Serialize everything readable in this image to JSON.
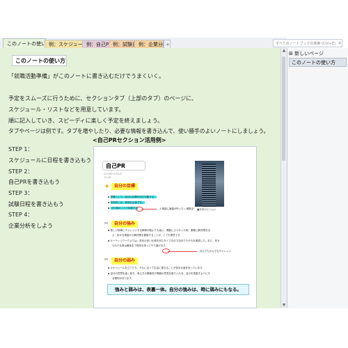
{
  "tabs": [
    {
      "label": "このノートの使い方"
    },
    {
      "label": "例：スケジュール"
    },
    {
      "label": "例：自己PR"
    },
    {
      "label": "例：試験日程"
    },
    {
      "label": "例：企業分析"
    }
  ],
  "tab_add_label": "+",
  "search": {
    "placeholder": "すべてのノートブックの検索 (Ctrl+E)"
  },
  "sidebar": {
    "new_page_label": "新しいページ",
    "pages": [
      {
        "label": "このノートの使い方"
      }
    ]
  },
  "page": {
    "title": "このノートの使い方",
    "lines": [
      "「就職活動準備」がこのノートに書き込むだけでうまくいく。",
      "予定をスムーズに行うために、セクションタブ（上部のタブ）のページに、",
      "スケジュール・リストなどを用意しています。",
      "順に記入していき、スピーディに楽しく予定を終えましょう。",
      "タブやページは例です。タブを増やしたり、必要な情報を書き込んで、使い勝手のよいノートにしましょう。"
    ],
    "caption": "<自己PRセクション活用例>",
    "steps": [
      "STEP 1：",
      "スケジュールに日程を書き込もう",
      "STEP 2：",
      "自己PRを書き込もう",
      "STEP 3：",
      "試験日程を書き込もう",
      "STEP 4：",
      "企業分析をしよう"
    ]
  },
  "preview": {
    "title": "自己PR",
    "date": "2016年11月4日",
    "time": "13:48",
    "goal_heading": "自分の目標",
    "goal_bullets": [
      "営業として、自分の目標を持ち行動する。",
      "将来的には、商品を企画する。",
      "1日1個のことで前進する"
    ],
    "goal_note": "人事部に面接が叶いたく頑張る!",
    "building_caption": "■未来のビジョン",
    "strength_heading": "自分の強み",
    "strength_bullets": [
      "新しい物事にチャレンジする精神が誰よりも強い。問題にぶつかった時、柔軟に解決策を出",
      "え、色々な角度から解決策を模索することが、とても得意です。",
      "ルーティンワークよりは、変化の多い仕事を好むタイプなので自分でもそれを実感した。また、任せ",
      "られた仕事は最後まで責任を持ってやり遂げます。"
    ],
    "strength_note": "なんでもかんでもチャレンジ",
    "weakness_heading": "自分の弱み",
    "weakness_bullets": [
      "スケジュールを立てたり、それに沿って生活に落ちることが苦手な面を持っています。",
      "目分の意思を強く持ち、考え方の柔軟性や周囲の意見を取り入れる、自分を見直すようにす",
      "る傾向があります。"
    ],
    "summary": "強みと弱みは、表裏一体。自分の強みは、時に弱みにもなる。"
  }
}
